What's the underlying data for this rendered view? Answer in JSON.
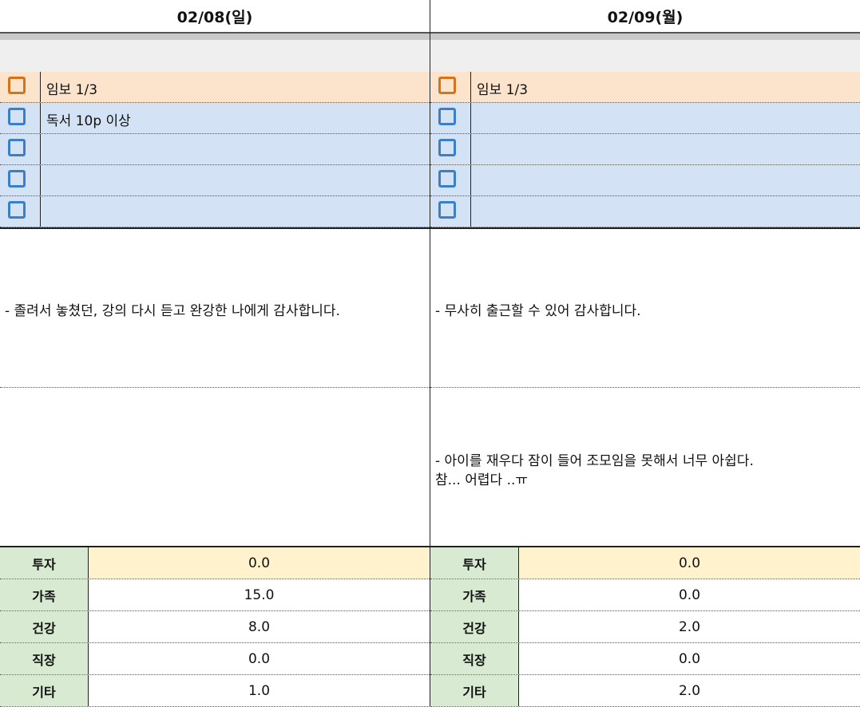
{
  "days": [
    {
      "date": "02/08(일)",
      "tasks": [
        "임보 1/3",
        "독서 10p 이상",
        "",
        "",
        ""
      ],
      "gratitude": "- 졸려서 놓쳤던, 강의 다시 듣고 완강한 나에게 감사합니다.",
      "regret_line1": "",
      "regret_line2": "",
      "scores": [
        {
          "label": "투자",
          "value": "0.0"
        },
        {
          "label": "가족",
          "value": "15.0"
        },
        {
          "label": "건강",
          "value": "8.0"
        },
        {
          "label": "직장",
          "value": "0.0"
        },
        {
          "label": "기타",
          "value": "1.0"
        }
      ]
    },
    {
      "date": "02/09(월)",
      "tasks": [
        "임보 1/3",
        "",
        "",
        "",
        ""
      ],
      "gratitude": "- 무사히 출근할 수 있어 감사합니다.",
      "regret_line1": "- 아이를 재우다 잠이 들어 조모임을 못해서 너무 아쉽다.",
      "regret_line2": "참... 어렵다 ..ㅠ",
      "scores": [
        {
          "label": "투자",
          "value": "0.0"
        },
        {
          "label": "가족",
          "value": "0.0"
        },
        {
          "label": "건강",
          "value": "2.0"
        },
        {
          "label": "직장",
          "value": "0.0"
        },
        {
          "label": "기타",
          "value": "2.0"
        }
      ]
    }
  ]
}
